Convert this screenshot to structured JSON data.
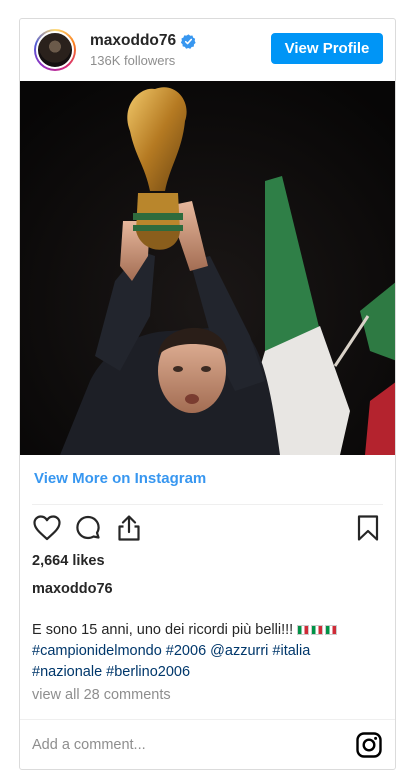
{
  "header": {
    "username": "maxoddo76",
    "followers": "136K followers",
    "view_profile_label": "View Profile"
  },
  "link": {
    "view_more_label": "View More on Instagram"
  },
  "stats": {
    "likes": "2,664 likes"
  },
  "caption": {
    "author": "maxoddo76",
    "text": "E sono 15 anni, uno dei ricordi più belli!!!",
    "hashtags_line1": "#campionidelmondo #2006 @azzurri #italia",
    "hashtags_line2": "#nazionale #berlino2006"
  },
  "comments": {
    "view_all_label": "view all 28 comments"
  },
  "comment_input": {
    "placeholder": "Add a comment..."
  },
  "colors": {
    "accent": "#0095f6",
    "link": "#3897f0",
    "hashtag": "#00376b"
  },
  "icons": [
    "verified-badge-icon",
    "heart-icon",
    "comment-icon",
    "share-icon",
    "bookmark-icon",
    "instagram-logo-icon"
  ]
}
